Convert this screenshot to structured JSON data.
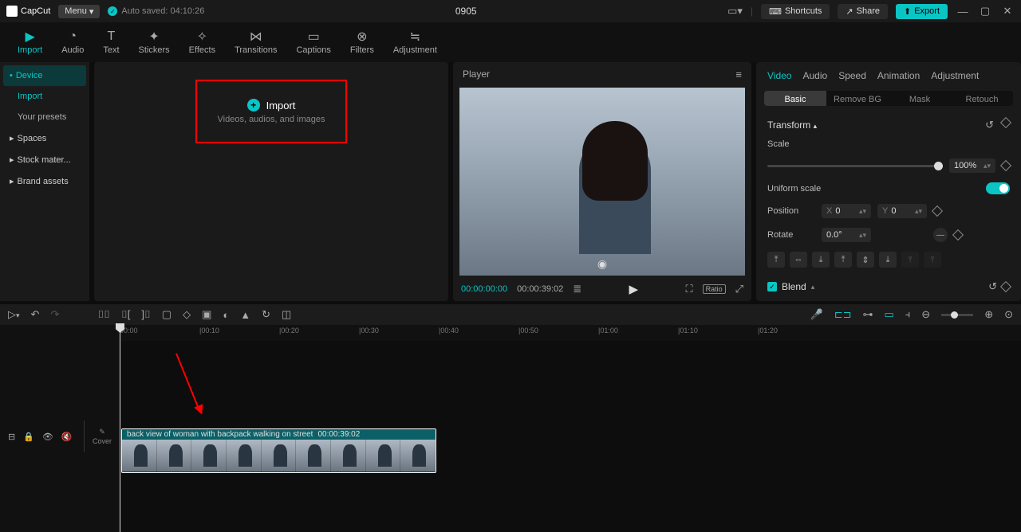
{
  "titlebar": {
    "app_name": "CapCut",
    "menu_label": "Menu",
    "autosave": "Auto saved: 04:10:26",
    "project_title": "0905",
    "shortcuts": "Shortcuts",
    "share": "Share",
    "export": "Export"
  },
  "toolbar": {
    "items": [
      {
        "label": "Import",
        "active": true
      },
      {
        "label": "Audio"
      },
      {
        "label": "Text"
      },
      {
        "label": "Stickers"
      },
      {
        "label": "Effects"
      },
      {
        "label": "Transitions"
      },
      {
        "label": "Captions"
      },
      {
        "label": "Filters"
      },
      {
        "label": "Adjustment"
      }
    ]
  },
  "sidebar": {
    "items": [
      {
        "label": "Device",
        "kind": "active"
      },
      {
        "label": "Import",
        "kind": "sub"
      },
      {
        "label": "Your presets",
        "kind": "sub2"
      },
      {
        "label": "Spaces",
        "kind": "plain"
      },
      {
        "label": "Stock mater...",
        "kind": "plain"
      },
      {
        "label": "Brand assets",
        "kind": "plain"
      }
    ]
  },
  "import": {
    "label": "Import",
    "hint": "Videos, audios, and images"
  },
  "player": {
    "title": "Player",
    "current": "00:00:00:00",
    "duration": "00:00:39:02"
  },
  "props": {
    "tabs": [
      "Video",
      "Audio",
      "Speed",
      "Animation",
      "Adjustment"
    ],
    "segtabs": [
      "Basic",
      "Remove BG",
      "Mask",
      "Retouch"
    ],
    "transform": "Transform",
    "scale_label": "Scale",
    "scale_value": "100%",
    "uniform": "Uniform scale",
    "position": "Position",
    "pos_x_label": "X",
    "pos_x": "0",
    "pos_y_label": "Y",
    "pos_y": "0",
    "rotate": "Rotate",
    "rotate_val": "0.0°",
    "blend": "Blend"
  },
  "timeline": {
    "marks": [
      "00:00",
      "|00:10",
      "|00:20",
      "|00:30",
      "|00:40",
      "|00:50",
      "|01:00",
      "|01:10",
      "|01:20"
    ],
    "cover": "Cover",
    "clip_name": "back view of woman with backpack walking on street",
    "clip_dur": "00:00:39:02"
  }
}
